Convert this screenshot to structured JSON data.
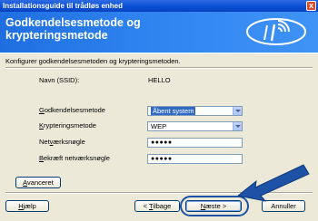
{
  "window": {
    "title": "Installationsguide til trådløs enhed",
    "close_label": "x"
  },
  "header": {
    "title": "Godkendelsesmetode og krypteringsmetode"
  },
  "instruction": "Konfigurer godkendelsesmetoden og krypteringsmetoden.",
  "ssid": {
    "label": "Navn (SSID):",
    "value": "HELLO"
  },
  "auth": {
    "label_ul": "G",
    "label_rest": "odkendelsesmetode",
    "value": "Åbent system"
  },
  "enc": {
    "label_ul": "K",
    "label_rest": "rypteringsmetode",
    "value": "WEP"
  },
  "key": {
    "label_pre": "Net",
    "label_ul": "v",
    "label_rest": "ærksnøgle",
    "value": "●●●●●"
  },
  "confirm": {
    "label_ul": "B",
    "label_rest": "ekræft netværksnøgle",
    "value": "●●●●●"
  },
  "buttons": {
    "advanced": {
      "ul": "A",
      "rest": "vanceret"
    },
    "help": {
      "pre": "",
      "ul": "H",
      "rest": "jælp"
    },
    "back": {
      "pre": "< ",
      "ul": "T",
      "rest": "ilbage"
    },
    "next": {
      "pre": "",
      "ul": "N",
      "rest": "æste >"
    },
    "cancel": {
      "label": "Annuller"
    }
  },
  "colors": {
    "header_blue": "#2f83f0",
    "pointer_arrow": "#1e52a6",
    "selection": "#316ac5"
  }
}
